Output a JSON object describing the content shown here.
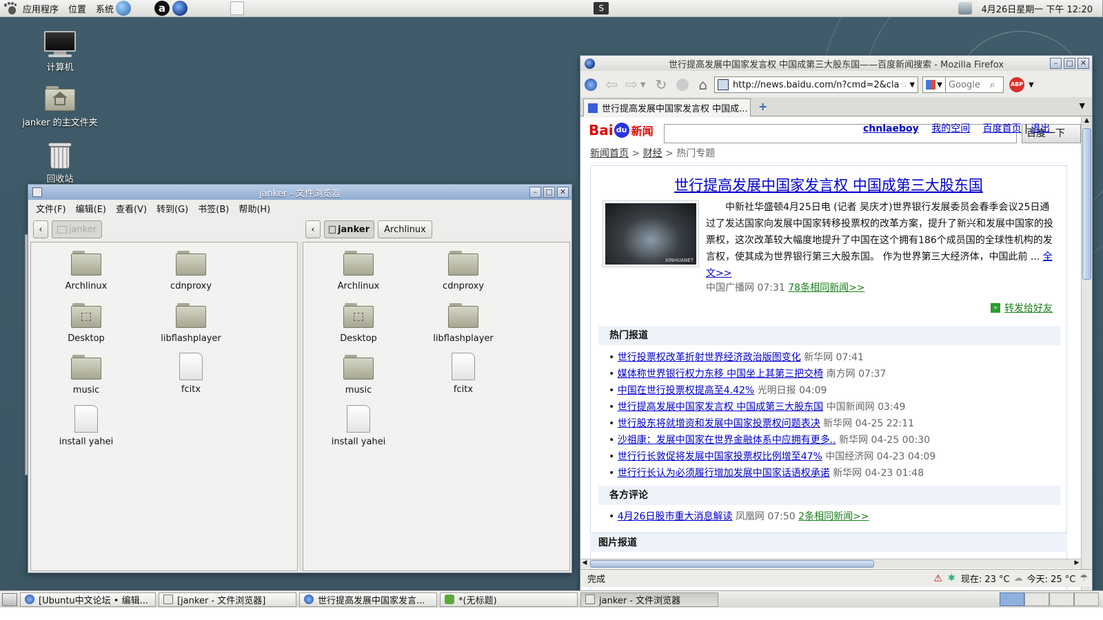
{
  "top_panel": {
    "menus": [
      "应用程序",
      "位置",
      "系统"
    ],
    "clock": "4月26日星期一 下午 12:20"
  },
  "desktop": {
    "icons": [
      {
        "label": "计算机",
        "icon": "computer-icon"
      },
      {
        "label": "janker 的主文件夹",
        "icon": "home-folder-icon"
      },
      {
        "label": "回收站",
        "icon": "trash-icon"
      }
    ]
  },
  "file_browser": {
    "title": "janker - 文件浏览器",
    "menus": [
      "文件(F)",
      "编辑(E)",
      "查看(V)",
      "转到(G)",
      "书签(B)",
      "帮助(H)"
    ],
    "left_pane": {
      "path": [
        "janker"
      ],
      "items": [
        {
          "name": "Archlinux",
          "type": "folder"
        },
        {
          "name": "cdnproxy",
          "type": "folder"
        },
        {
          "name": "Desktop",
          "type": "desktop-folder"
        },
        {
          "name": "libflashplayer",
          "type": "folder"
        },
        {
          "name": "music",
          "type": "folder"
        },
        {
          "name": "fcitx",
          "type": "file"
        },
        {
          "name": "install yahei",
          "type": "file"
        }
      ]
    },
    "right_pane": {
      "path": [
        "janker",
        "Archlinux"
      ],
      "items": [
        {
          "name": "Archlinux",
          "type": "folder"
        },
        {
          "name": "cdnproxy",
          "type": "folder"
        },
        {
          "name": "Desktop",
          "type": "desktop-folder"
        },
        {
          "name": "libflashplayer",
          "type": "folder"
        },
        {
          "name": "music",
          "type": "folder"
        },
        {
          "name": "fcitx",
          "type": "file"
        },
        {
          "name": "install yahei",
          "type": "file"
        }
      ]
    }
  },
  "firefox": {
    "title": "世行提高发展中国家发言权 中国成第三大股东国——百度新闻搜索 - Mozilla Firefox",
    "url": "http://news.baidu.com/n?cmd=2&clas:",
    "search_placeholder": "Google",
    "tab_label": "世行提高发展中国家发言权 中国成...",
    "status": "完成",
    "weather_now": "现在: 23 °C",
    "weather_today": "今天: 25 °C",
    "page": {
      "logo_text": "Bai",
      "logo_text2": "du",
      "logo_news": "新闻",
      "user_links": [
        "chnlaeboy",
        "我的空间",
        "百度首页",
        "退出"
      ],
      "search_btn": "百度一下",
      "breadcrumb": [
        "新闻首页",
        "财经",
        "热门专题"
      ],
      "headline": "世行提高发展中国家发言权 中国成第三大股东国",
      "image_caption": "XINHUANET",
      "summary": "中新社华盛顿4月25日电 (记者 吴庆才)世界银行发展委员会春季会议25日通过了发达国家向发展中国家转移投票权的改革方案，提升了新兴和发展中国家的投票权，这次改革较大幅度地提升了中国在这个拥有186个成员国的全球性机构的发言权，使其成为世界银行第三大股东国。 作为世界第三大经济体，中国此前 ... ",
      "full_text_link": "全文>>",
      "source": "中国广播网 07:31",
      "related": "78条相同新闻>>",
      "forward": "转发给好友",
      "hot_title": "热门报道",
      "hot": [
        {
          "title": "世行投票权改革折射世界经济政治版图变化",
          "src": "新华网 07:41"
        },
        {
          "title": "媒体称世界银行权力东移 中国坐上其第三把交椅",
          "src": "南方网 07:37"
        },
        {
          "title": "中国在世行投票权提高至4.42%",
          "src": "光明日报 04:09"
        },
        {
          "title": "世行提高发展中国家发言权 中国成第三大股东国",
          "src": "中国新闻网 03:49"
        },
        {
          "title": "世行股东将就增资和发展中国家投票权问题表决",
          "src": "新华网 04-25 22:11"
        },
        {
          "title": "沙祖康：发展中国家在世界金融体系中应拥有更多..",
          "src": "新华网 04-25 00:30"
        },
        {
          "title": "世行行长敦促将发展中国家投票权比例增至47%",
          "src": "中国经济网 04-23 04:09"
        },
        {
          "title": "世行行长认为必须履行增加发展中国家话语权承诺",
          "src": "新华网 04-23 01:48"
        }
      ],
      "comment_title": "各方评论",
      "comments": [
        {
          "title": "4月26日股市重大消息解读",
          "src": "凤凰网 07:50",
          "related": "2条相同新闻>>"
        }
      ],
      "photo_title": "图片报道"
    }
  },
  "taskbar": {
    "tasks": [
      {
        "label": "[Ubuntu中文论坛 • 编辑...",
        "active": false
      },
      {
        "label": "[janker - 文件浏览器]",
        "active": false
      },
      {
        "label": "世行提高发展中国家发言...",
        "active": false
      },
      {
        "label": "*(无标题)",
        "active": false
      },
      {
        "label": "janker - 文件浏览器",
        "active": true
      }
    ]
  }
}
